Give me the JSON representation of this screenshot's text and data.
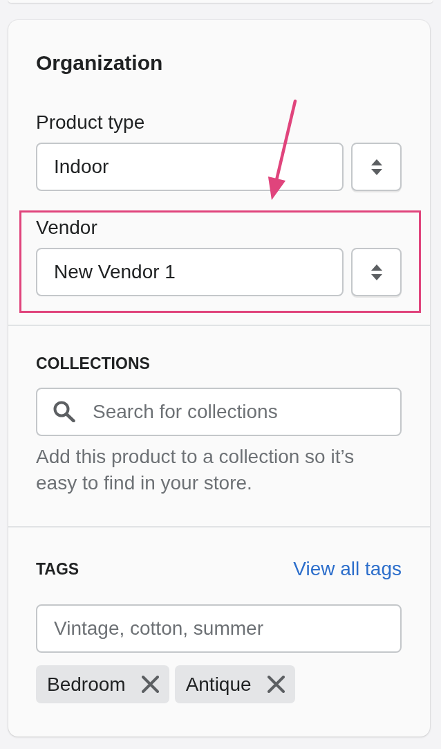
{
  "organization": {
    "title": "Organization",
    "fields": [
      {
        "label": "Product type",
        "value": "Indoor",
        "highlighted": false
      },
      {
        "label": "Vendor",
        "value": "New Vendor 1",
        "highlighted": true
      }
    ]
  },
  "collections": {
    "title": "COLLECTIONS",
    "search": {
      "placeholder": "Search for collections"
    },
    "help_text": "Add this product to a collection so it’s easy to find in your store."
  },
  "tags": {
    "title": "TAGS",
    "link": "View all tags",
    "input": {
      "placeholder": "Vintage, cotton, summer"
    },
    "items": [
      {
        "label": "Bedroom"
      },
      {
        "label": "Antique"
      }
    ]
  }
}
